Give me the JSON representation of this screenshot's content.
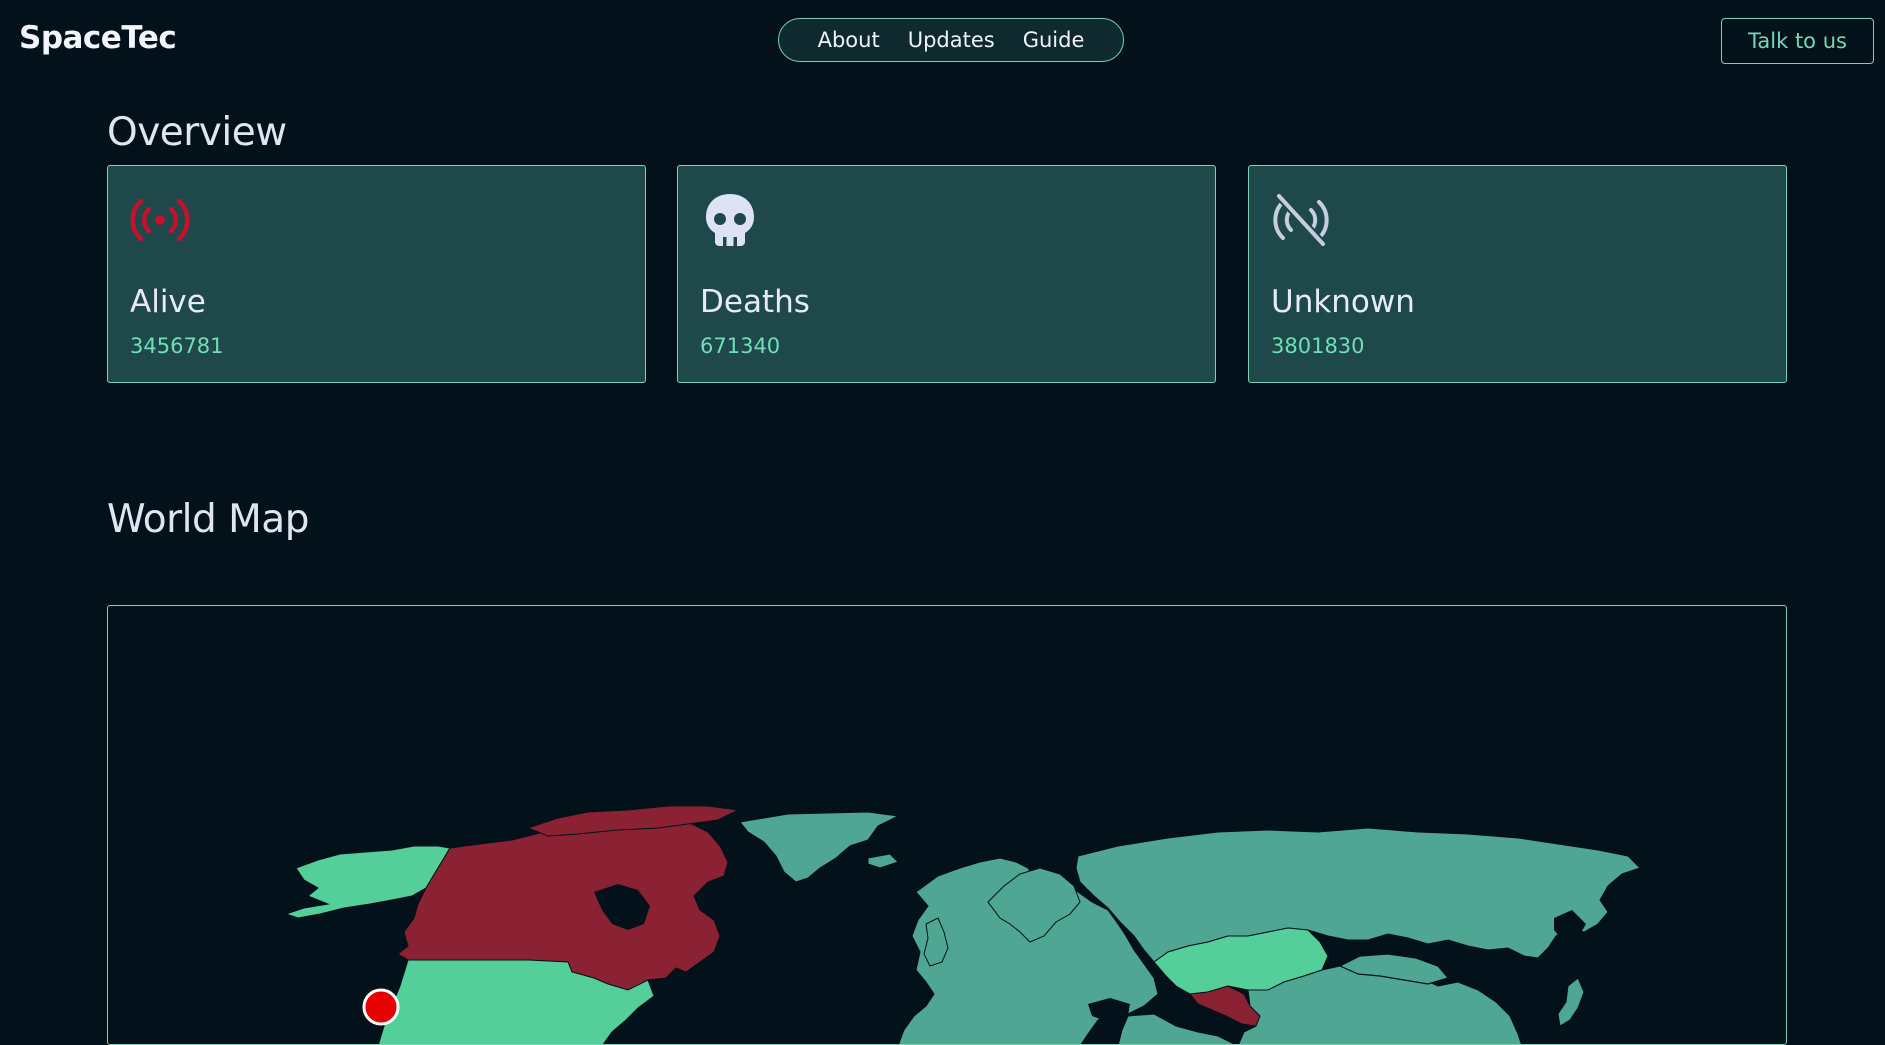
{
  "header": {
    "brand": "SpaceTec",
    "nav": [
      "About",
      "Updates",
      "Guide"
    ],
    "cta_label": "Talk to us"
  },
  "overview": {
    "title": "Overview",
    "cards": [
      {
        "label": "Alive",
        "value": "3456781",
        "icon": "broadcast-icon",
        "icon_color": "#c5102e"
      },
      {
        "label": "Deaths",
        "value": "671340",
        "icon": "skull-icon",
        "icon_color": "#dde3f4"
      },
      {
        "label": "Unknown",
        "value": "3801830",
        "icon": "signal-off-icon",
        "icon_color": "#c7cde0"
      }
    ]
  },
  "world_map": {
    "title": "World Map",
    "colors": {
      "alive": "#55cf99",
      "deaths": "#8b2233",
      "default": "#4fa692",
      "marker": "#e60000"
    }
  }
}
